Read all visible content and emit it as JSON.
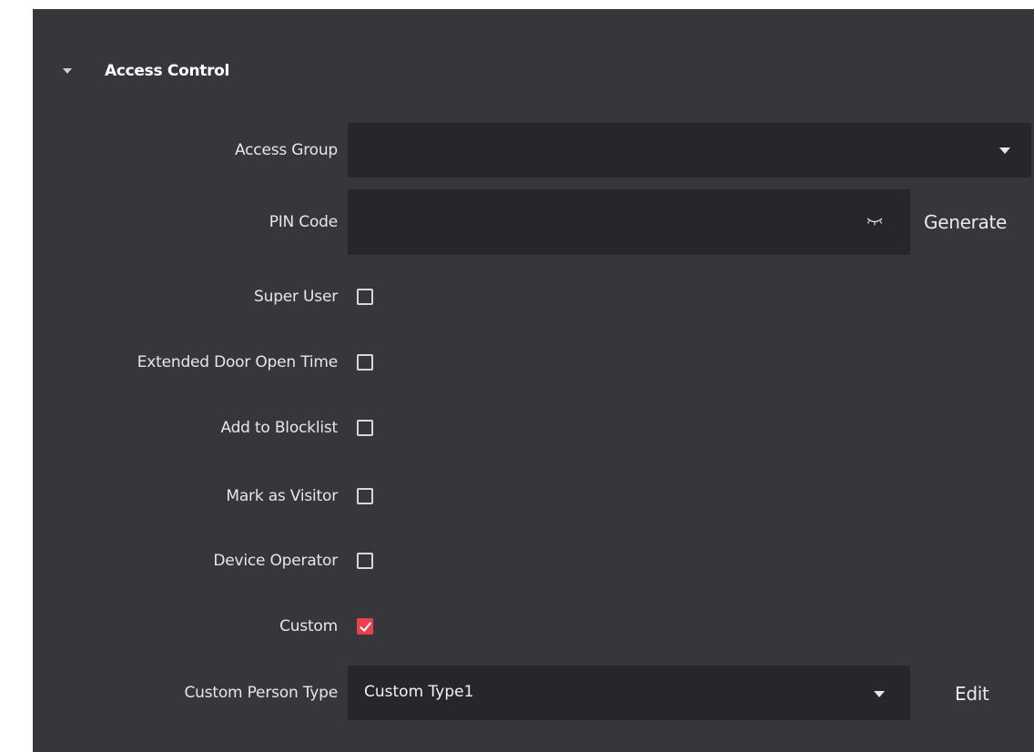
{
  "section": {
    "title": "Access Control"
  },
  "fields": {
    "access_group": {
      "label": "Access Group",
      "value": ""
    },
    "pin_code": {
      "label": "PIN Code",
      "value": "",
      "generate_label": "Generate"
    },
    "super_user": {
      "label": "Super User",
      "checked": false
    },
    "extended_door_open_time": {
      "label": "Extended Door Open Time",
      "checked": false
    },
    "add_to_blocklist": {
      "label": "Add to Blocklist",
      "checked": false
    },
    "mark_as_visitor": {
      "label": "Mark as Visitor",
      "checked": false
    },
    "device_operator": {
      "label": "Device Operator",
      "checked": false
    },
    "custom": {
      "label": "Custom",
      "checked": true
    },
    "custom_person_type": {
      "label": "Custom Person Type",
      "value": "Custom Type1",
      "edit_label": "Edit"
    }
  },
  "colors": {
    "panel_bg": "#35373b",
    "input_bg": "#26272b",
    "checkbox_checked": "#e8414b",
    "text": "#e6e7e8"
  }
}
